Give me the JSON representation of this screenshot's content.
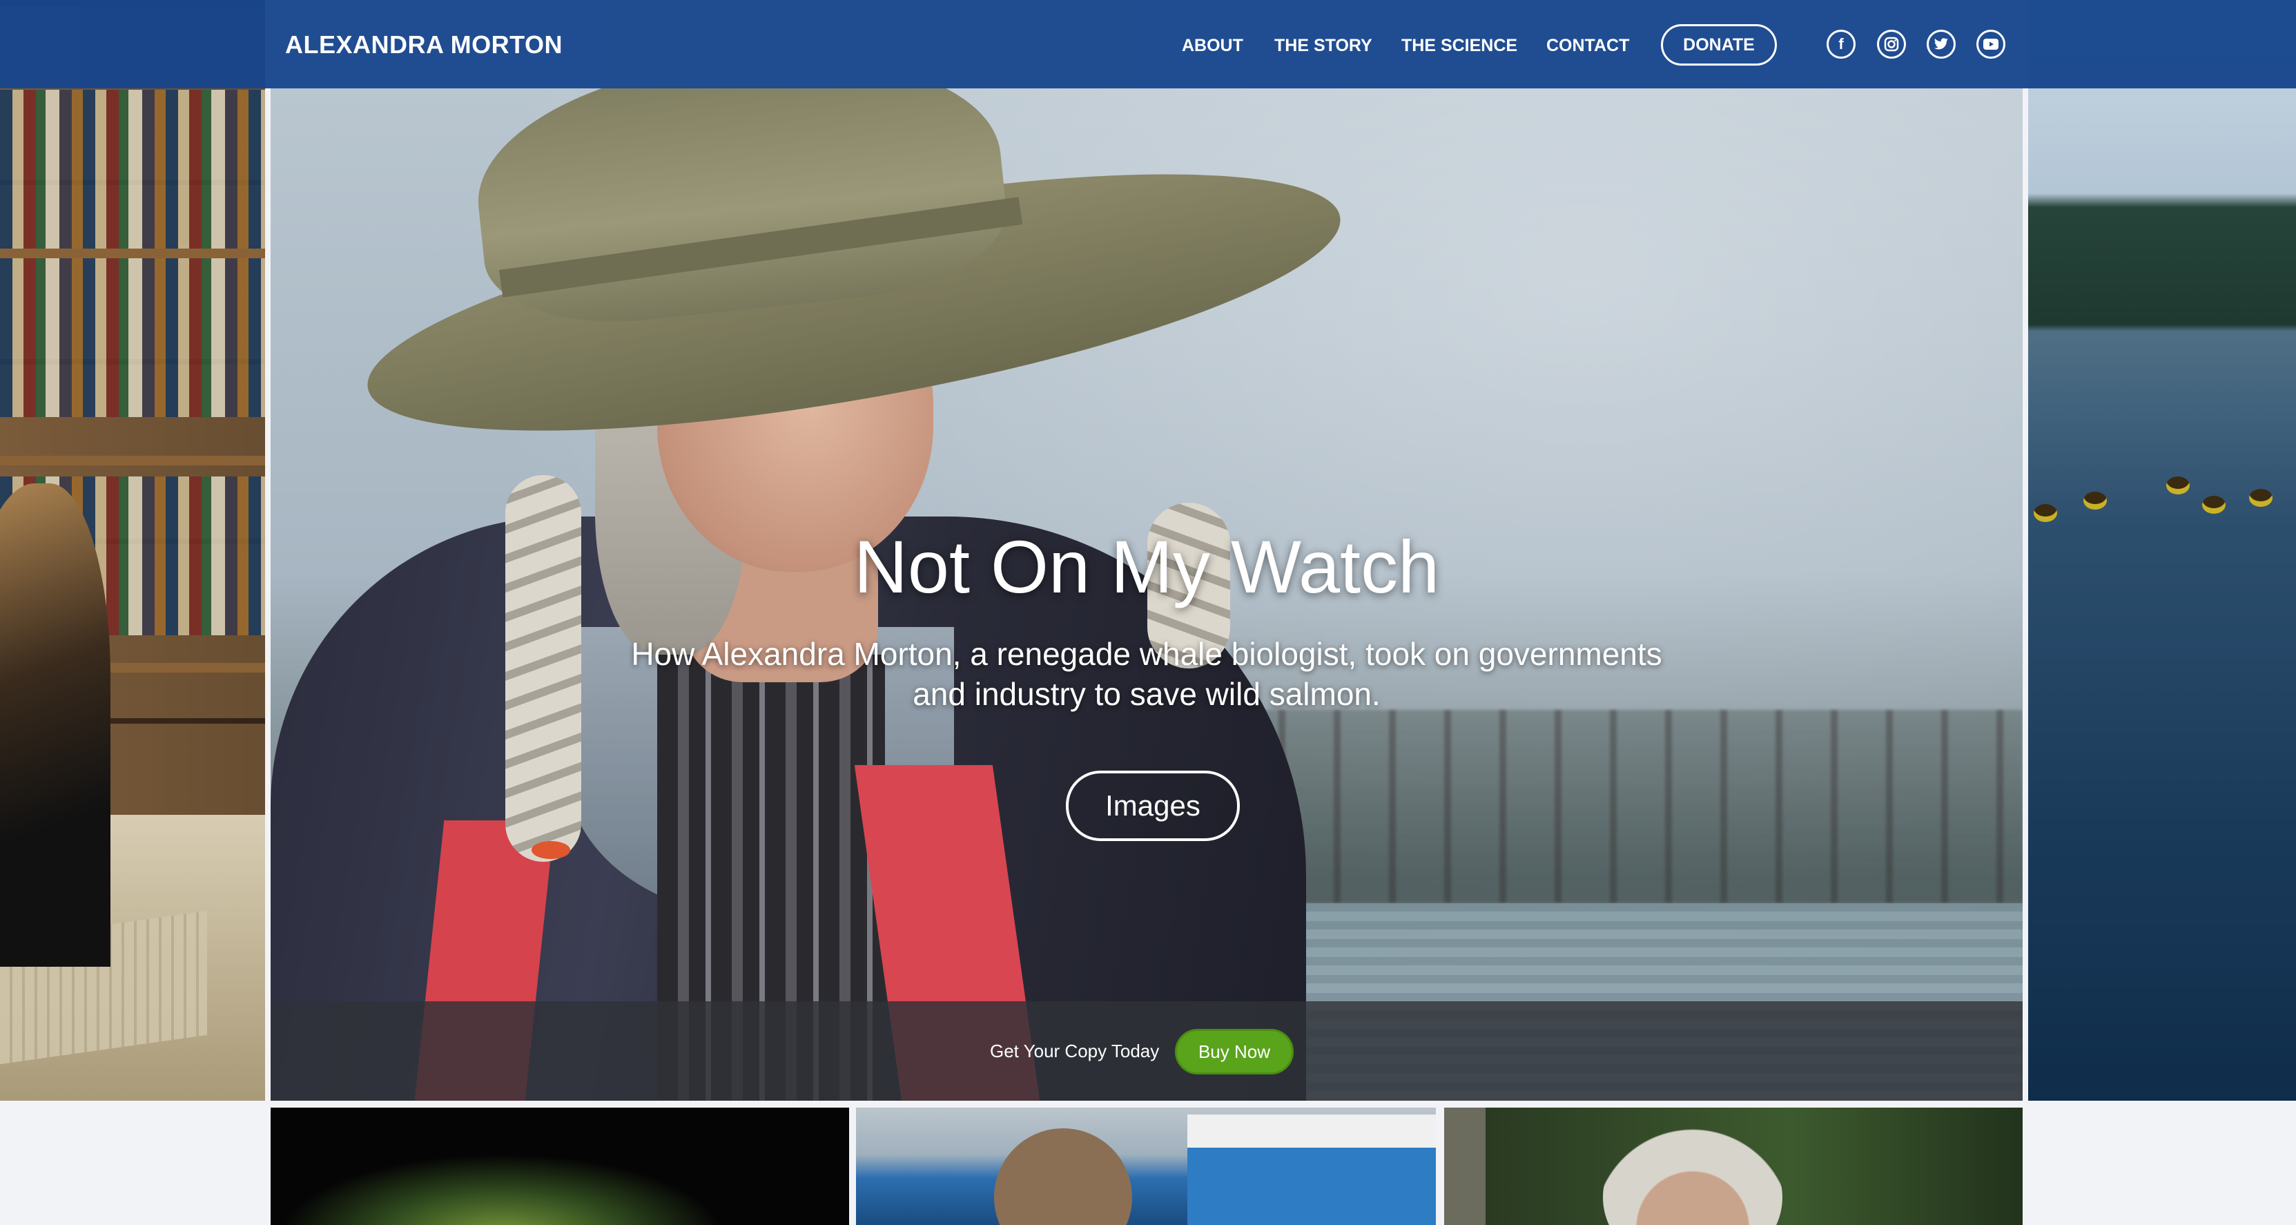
{
  "brand": "ALEXANDRA MORTON",
  "nav": {
    "items": [
      {
        "label": "ABOUT"
      },
      {
        "label": "THE STORY"
      },
      {
        "label": "THE SCIENCE"
      },
      {
        "label": "CONTACT"
      }
    ],
    "donate": "DONATE",
    "social": [
      {
        "icon": "facebook-icon",
        "glyph": "f"
      },
      {
        "icon": "instagram-icon",
        "glyph": "◎"
      },
      {
        "icon": "twitter-icon",
        "glyph": "🐦"
      },
      {
        "icon": "youtube-icon",
        "glyph": "▶"
      }
    ]
  },
  "hero": {
    "title": "Not On My Watch",
    "subtitle_line1": "How Alexandra Morton, a renegade whale biologist, took on governments",
    "subtitle_line2": "and industry to save wild salmon.",
    "button": "Images"
  },
  "buy_bar": {
    "text": "Get Your Copy Today",
    "button": "Buy Now"
  },
  "colors": {
    "nav_bg": "#17468c",
    "buy_button": "#5aa41c"
  }
}
